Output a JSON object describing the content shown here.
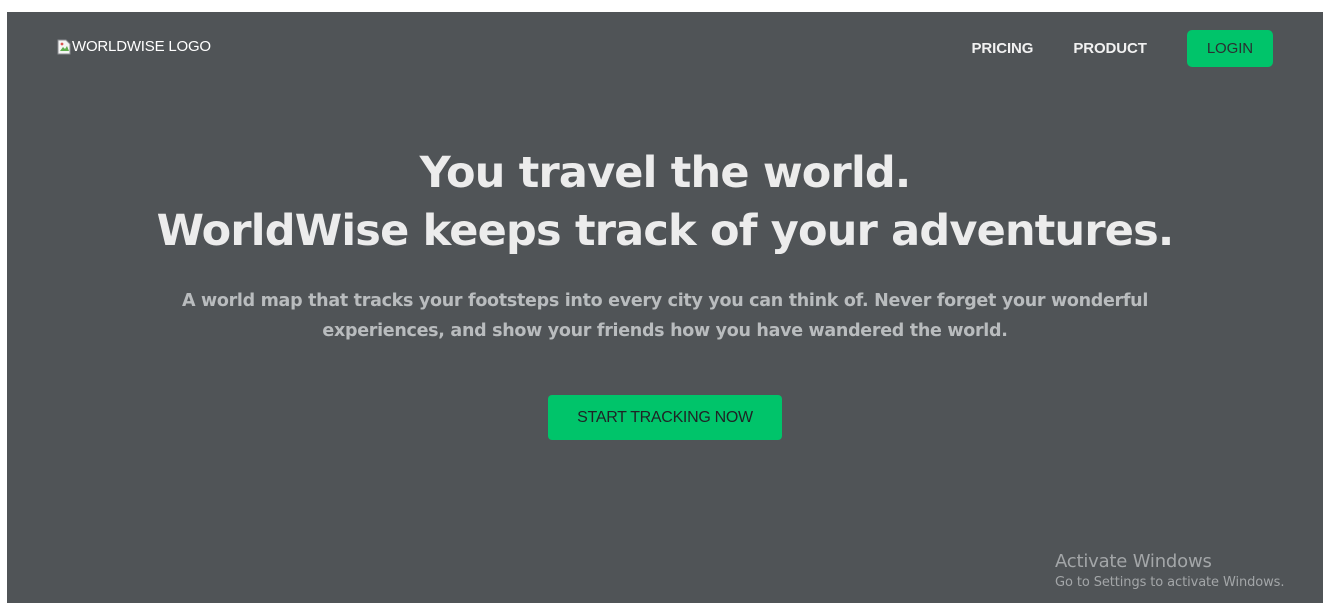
{
  "header": {
    "logo_alt": "WORLDWISE LOGO",
    "logo_icon": "broken-image-icon",
    "nav": {
      "pricing_label": "PRICING",
      "product_label": "PRODUCT",
      "login_label": "LOGIN"
    }
  },
  "hero": {
    "title_line1": "You travel the world.",
    "title_line2": "WorldWise keeps track of your adventures.",
    "subtitle": "A world map that tracks your footsteps into every city you can think of. Never forget your wonderful experiences, and show your friends how you have wandered the world.",
    "cta_label": "START TRACKING NOW"
  },
  "watermark": {
    "title": "Activate Windows",
    "subtitle": "Go to Settings to activate Windows."
  },
  "colors": {
    "background": "#505457",
    "accent": "#00c46a",
    "title_text": "#ececec",
    "subtitle_text": "#b9bcbe"
  }
}
